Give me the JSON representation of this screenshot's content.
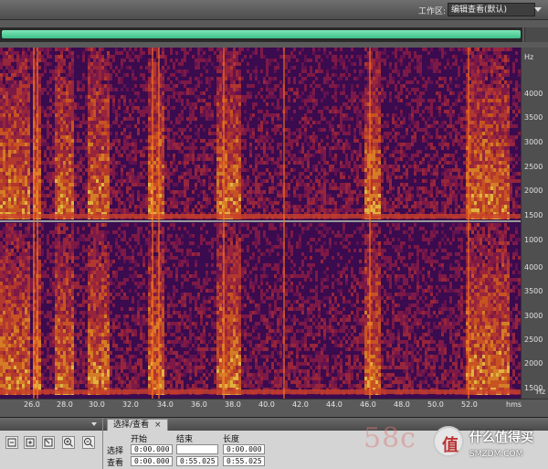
{
  "workspace": {
    "label": "工作区:",
    "value": "编辑查看(默认)"
  },
  "frequency_axis": {
    "unit": "Hz",
    "top_ticks": [
      "4000",
      "3500",
      "3000",
      "2500",
      "2000",
      "1500",
      "1000"
    ],
    "bottom_ticks": [
      "4000",
      "3500",
      "3000",
      "2500",
      "2000",
      "1500"
    ]
  },
  "time_axis": {
    "ticks": [
      "26.0",
      "28.0",
      "30.0",
      "32.0",
      "34.0",
      "36.0",
      "38.0",
      "40.0",
      "42.0",
      "44.0",
      "46.0",
      "48.0",
      "50.0",
      "52.0"
    ],
    "unit": "hms"
  },
  "selection_panel": {
    "tab_label": "选择/查看",
    "tab_close": "×",
    "col_start": "开始",
    "col_end": "结束",
    "col_length": "长度",
    "row_select": "选择",
    "row_view": "查看",
    "select_start": "0:00.000",
    "select_end": "",
    "select_length": "0:00.000",
    "view_start": "0:00.000",
    "view_end": "0:55.025",
    "view_length": "0:55.025"
  },
  "watermark": {
    "text": "58c"
  },
  "brand": {
    "logo_char": "值",
    "name": "什么值得买",
    "url": "SMZDM.COM"
  },
  "colors": {
    "overview_bar": "#3cc08a",
    "spectrogram_base": "#2a0a4a",
    "hot": "#ffcc33"
  }
}
